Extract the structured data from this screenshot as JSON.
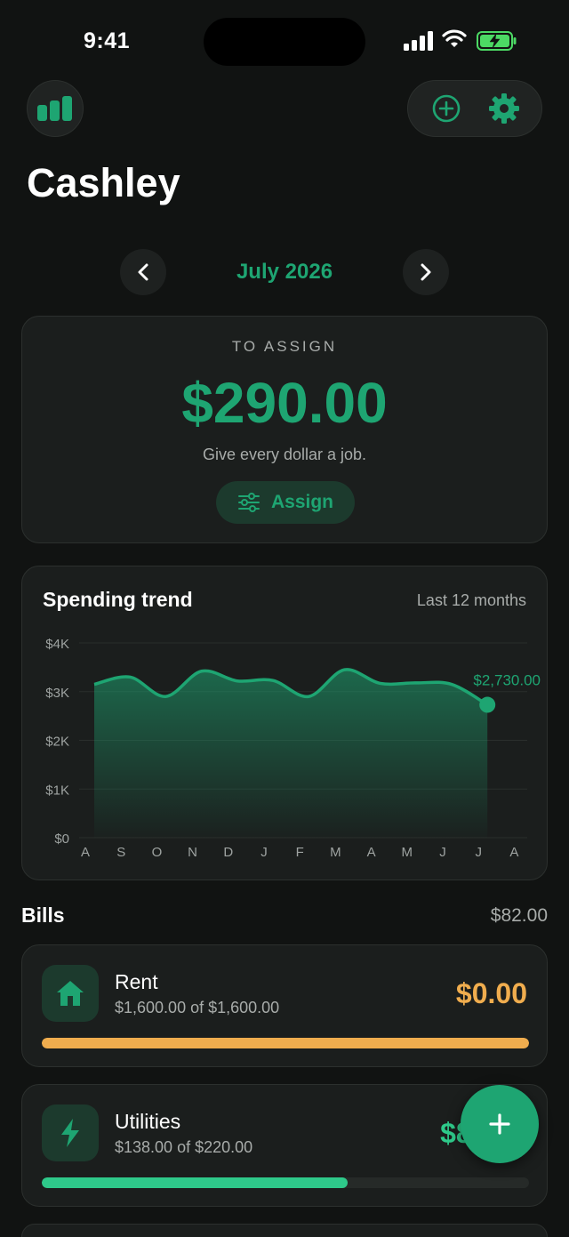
{
  "status_bar": {
    "time": "9:41"
  },
  "header": {
    "title": "Cashley",
    "stats_icon": "bar-chart-icon",
    "add_icon": "plus-circle-icon",
    "settings_icon": "gear-icon"
  },
  "month_nav": {
    "label": "July 2026"
  },
  "assign_card": {
    "label": "TO ASSIGN",
    "amount": "$290.00",
    "subtitle": "Give every dollar a job.",
    "button_label": "Assign"
  },
  "trend_card": {
    "title": "Spending trend",
    "range": "Last 12 months",
    "last_value_label": "$2,730.00"
  },
  "chart_data": {
    "type": "area",
    "title": "Spending trend",
    "x": [
      "A",
      "S",
      "O",
      "N",
      "D",
      "J",
      "F",
      "M",
      "A",
      "M",
      "J",
      "J",
      "A"
    ],
    "y_ticks": [
      "$0",
      "$1K",
      "$2K",
      "$3K",
      "$4K"
    ],
    "ylim": [
      0,
      4000
    ],
    "values": [
      3150,
      3300,
      2900,
      3420,
      3220,
      3230,
      2900,
      3450,
      3170,
      3180,
      3150,
      2730,
      null
    ],
    "grid": true,
    "color": "#1ea572"
  },
  "bills": {
    "title": "Bills",
    "total": "$82.00",
    "items": [
      {
        "name": "Rent",
        "sub": "$1,600.00 of $1,600.00",
        "amount": "$0.00",
        "icon": "house-icon",
        "progress": 1.0,
        "color": "#f0ad4e"
      },
      {
        "name": "Utilities",
        "sub": "$138.00 of $220.00",
        "amount": "$82.00",
        "icon": "bolt-icon",
        "progress": 0.627,
        "color": "#2ec98a"
      }
    ]
  },
  "fab": {
    "icon": "plus-icon",
    "label": "+"
  },
  "colors": {
    "accent": "#1ea572",
    "background": "#111312",
    "card": "#1b1e1d",
    "warning": "#f0ad4e"
  }
}
